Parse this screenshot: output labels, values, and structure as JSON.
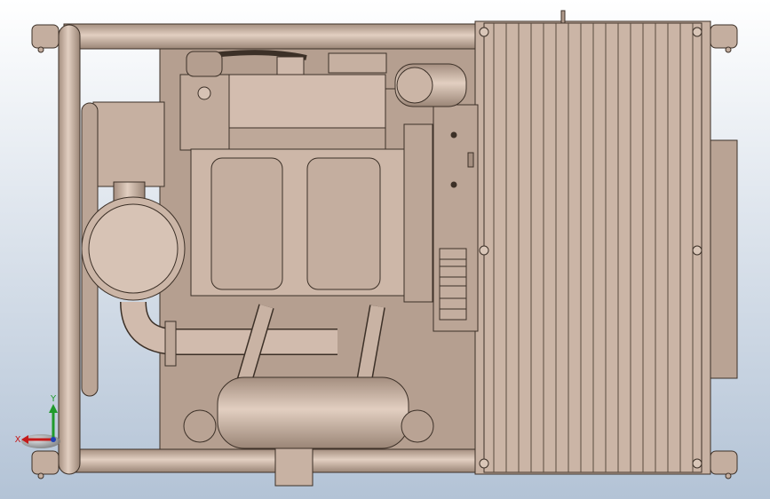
{
  "viewport": {
    "background_top": "#ffffff",
    "background_bottom": "#b3c3d6"
  },
  "model": {
    "body_color": "#cdb6a6",
    "shadow_color": "#a58f80",
    "edge_color": "#3c3027",
    "heatsink_color": "#c8b2a3"
  },
  "triad": {
    "x_label": "X",
    "y_label": "Y",
    "x_color": "#c41a1a",
    "y_color": "#1f9a2b",
    "z_color": "#1f3fb4"
  }
}
